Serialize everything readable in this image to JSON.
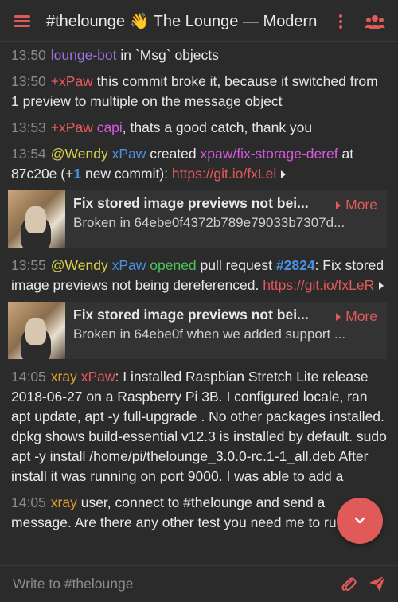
{
  "header": {
    "title": "#thelounge",
    "emoji": "👋",
    "topic": "The Lounge — Modern"
  },
  "messages": [
    {
      "time": "13:50",
      "nick": "lounge-bot",
      "text": "in `Msg` objects"
    },
    {
      "time": "13:50",
      "nick": "+xPaw",
      "text": "this commit broke it, because it switched from 1 preview to multiple on the message object"
    },
    {
      "time": "13:53",
      "nick": "+xPaw",
      "mention": "capi",
      "text": ", thats a good catch, thank you"
    },
    {
      "time": "13:54",
      "nick": "@Wendy",
      "actor": "xPaw",
      "verb": "created",
      "branch": "xpaw/fix-storage-deref",
      "at": "at",
      "commit": "87c20e",
      "plus": "(+",
      "count": "1",
      "rest": "new commit):",
      "link": "https://git.io/fxLel"
    },
    {
      "time": "13:55",
      "nick": "@Wendy",
      "actor": "xPaw",
      "verb": "opened",
      "pre": "pull request",
      "pr": "#2824",
      "text": ": Fix stored image previews not being dereferenced.",
      "link": "https://git.io/fxLeR"
    },
    {
      "time": "14:05",
      "nick": "xray",
      "mention": "xPaw",
      "text": ": I installed  Raspbian Stretch Lite release 2018-06-27 on a Raspberry Pi 3B. I configured locale, ran apt update, apt -y full-upgrade . No other packages installed. dpkg shows build-essential v12.3 is installed by default. sudo apt -y install /home/pi/thelounge_3.0.0-rc.1-1_all.deb After install it was running on port 9000. I was able to add a"
    },
    {
      "time": "14:05",
      "nick": "xray",
      "text": " user, connect to #thelounge and send a message. Are there any other test you need me to run?"
    }
  ],
  "previews": [
    {
      "title": "Fix stored image previews not bei...",
      "desc": "Broken in 64ebe0f4372b789e79033b7307d...",
      "more": "More"
    },
    {
      "title": "Fix stored image previews not bei...",
      "desc": "Broken in 64ebe0f when we added support ...",
      "more": "More"
    }
  ],
  "input": {
    "placeholder": "Write to #thelounge"
  },
  "colors": {
    "accent": "#e05a5a",
    "background": "#2b2b2b"
  }
}
